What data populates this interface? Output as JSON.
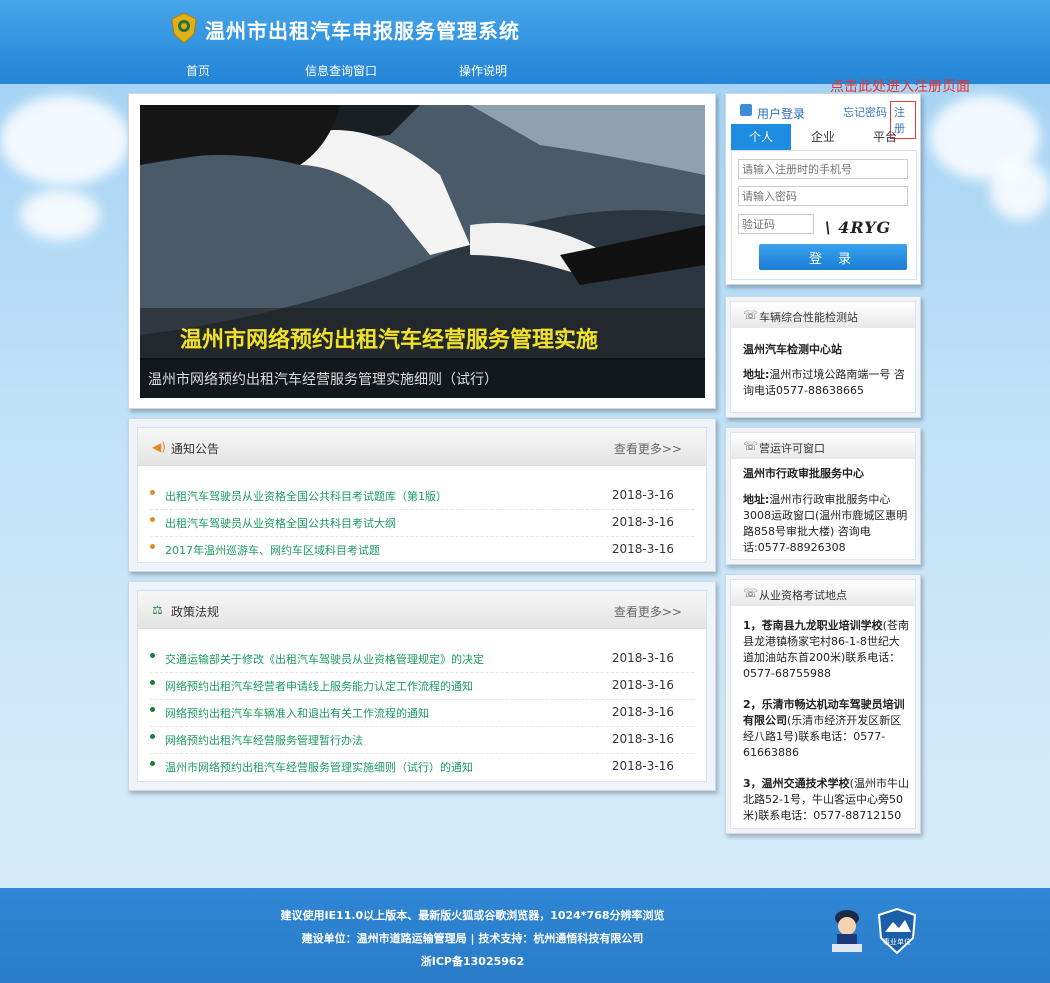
{
  "header": {
    "title": "温州市出租汽车申报服务管理系统"
  },
  "nav": [
    {
      "label": "首页"
    },
    {
      "label": "信息查询窗口"
    },
    {
      "label": "操作说明"
    }
  ],
  "register_hint": "点击此处进入注册页面",
  "banner": {
    "headline": "温州市网络预约出租汽车经营服务管理实施",
    "caption": "温州市网络预约出租汽车经营服务管理实施细则（试行）",
    "slides": 4,
    "active_slide": 2
  },
  "notice": {
    "title": "通知公告",
    "more": "查看更多>>",
    "items": [
      {
        "text": "出租汽车驾驶员从业资格全国公共科目考试题库（第1版）",
        "date": "2018-3-16"
      },
      {
        "text": "出租汽车驾驶员从业资格全国公共科目考试大纲",
        "date": "2018-3-16"
      },
      {
        "text": "2017年温州巡游车、网约车区域科目考试题",
        "date": "2018-3-16"
      }
    ]
  },
  "policy": {
    "title": "政策法规",
    "more": "查看更多>>",
    "items": [
      {
        "text": "交通运输部关于修改《出租汽车驾驶员从业资格管理规定》的决定",
        "date": "2018-3-16"
      },
      {
        "text": "网络预约出租汽车经营者申请线上服务能力认定工作流程的通知",
        "date": "2018-3-16"
      },
      {
        "text": "网络预约出租汽车车辆准入和退出有关工作流程的通知",
        "date": "2018-3-16"
      },
      {
        "text": "网络预约出租汽车经营服务管理暂行办法",
        "date": "2018-3-16"
      },
      {
        "text": "温州市网络预约出租汽车经营服务管理实施细则（试行）的通知",
        "date": "2018-3-16"
      }
    ]
  },
  "login": {
    "title": "用户登录",
    "forgot": "忘记密码",
    "register": "注册",
    "tabs": [
      "个人",
      "企业",
      "平台"
    ],
    "phone_placeholder": "请输入注册时的手机号",
    "password_placeholder": "请输入密码",
    "captcha_placeholder": "验证码",
    "captcha_text": "\\ 4RYG",
    "submit": "登 录"
  },
  "inspection": {
    "title": "车辆综合性能检测站",
    "name": "温州汽车检测中心站",
    "address_label": "地址:",
    "address": "温州市过境公路南端一号 咨询电话0577-88638665"
  },
  "permit": {
    "title": "营运许可窗口",
    "name": "温州市行政审批服务中心",
    "address_label": "地址:",
    "address": "温州市行政审批服务中心3008运政窗口(温州市鹿城区惠明路858号审批大楼) 咨询电话:0577-88926308"
  },
  "exam": {
    "title": "从业资格考试地点",
    "sites": [
      {
        "name": "1，苍南县九龙职业培训学校",
        "detail": "(苍南县龙港镇杨家宅村86-1-8世纪大道加油站东首200米)联系电话：0577-68755988"
      },
      {
        "name": "2，乐清市畅达机动车驾驶员培训有限公司",
        "detail": "(乐清市经济开发区新区经八路1号)联系电话：0577-61663886"
      },
      {
        "name": "3，温州交通技术学校",
        "detail": "(温州市牛山北路52-1号，牛山客运中心旁50米)联系电话：0577-88712150"
      }
    ]
  },
  "footer": {
    "line1": "建议使用IE11.0以上版本、最新版火狐或谷歌浏览器，1024*768分辨率浏览",
    "line2": "建设单位：温州市道路运输管理局 | 技术支持：杭州通悟科技有限公司",
    "line3": "浙ICP备13025962",
    "badge_text": "事业单位"
  },
  "colors": {
    "header_blue": "#2d8fdd",
    "link_green": "#1d9c62",
    "active_dot": "#1e8a3c",
    "register_red": "#e83030"
  }
}
